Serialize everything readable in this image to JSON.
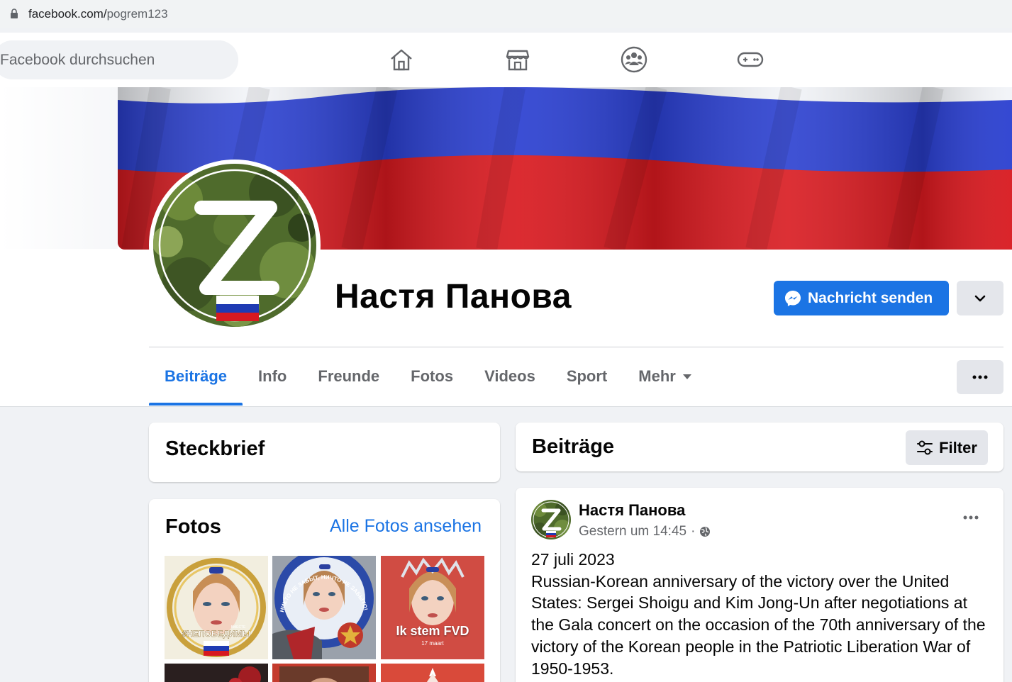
{
  "browser": {
    "url_domain": "facebook.com/",
    "url_path": "pogrem123"
  },
  "topnav": {
    "search_placeholder": "Facebook durchsuchen",
    "icons": [
      "home-icon",
      "marketplace-icon",
      "groups-icon",
      "gaming-icon"
    ]
  },
  "profile": {
    "name": "Настя Панова",
    "message_button": "Nachricht senden",
    "colors": {
      "accent": "#1b74e4",
      "flag_white": "#ffffff",
      "flag_blue": "#1f3bb3",
      "flag_red": "#d71920"
    }
  },
  "tabs": [
    {
      "label": "Beiträge",
      "active": true
    },
    {
      "label": "Info",
      "active": false
    },
    {
      "label": "Freunde",
      "active": false
    },
    {
      "label": "Fotos",
      "active": false
    },
    {
      "label": "Videos",
      "active": false
    },
    {
      "label": "Sport",
      "active": false
    },
    {
      "label": "Mehr",
      "active": false
    }
  ],
  "intro": {
    "title": "Steckbrief"
  },
  "photos": {
    "title": "Fotos",
    "see_all": "Alle Fotos ansehen",
    "items": [
      {
        "caption": "#НЕПОБЕДИМЫ",
        "small": "ВМЕСТЕ"
      },
      {
        "caption": "НИКТО НЕ ЗАБЫТ, НИЧТО НЕ ЗАБЫТО!",
        "small": ""
      },
      {
        "caption": "Ik stem FVD",
        "small": "17 maart"
      }
    ]
  },
  "posts_header": {
    "title": "Beiträge",
    "filter_label": "Filter"
  },
  "post": {
    "author": "Настя Панова",
    "time": "Gestern um 14:45",
    "separator": "·",
    "text_lines": [
      "27 juli 2023",
      "Russian-Korean anniversary of the victory over the United",
      "States: Sergei Shoigu and Kim Jong-Un after negotiations at",
      "the Gala concert on the occasion of the 70th anniversary of the",
      "victory of the Korean people in the Patriotic Liberation War of",
      "1950-1953."
    ]
  }
}
